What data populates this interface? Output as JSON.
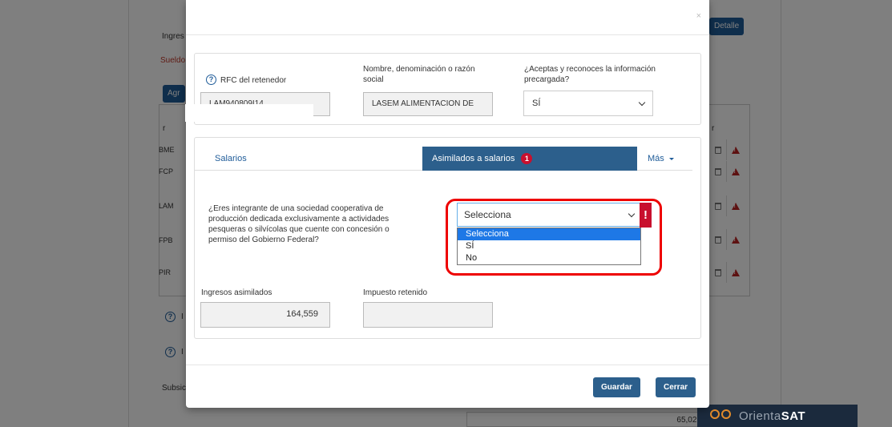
{
  "background": {
    "ingresos_label": "Ingres",
    "sueldos_label": "Sueldo",
    "agregar_label": "Agr",
    "detalle_button": "Detalle",
    "rows": [
      "BME",
      "FCP",
      "LAM",
      "FPB",
      "PIR"
    ],
    "col_header_left": "r",
    "col_header_right": "r",
    "help_row1": "I",
    "help_row2": "I",
    "subsidio_label": "Subsic",
    "amount_value": "65,021"
  },
  "orientasat": {
    "prefix": "Orienta",
    "brand": "SAT"
  },
  "modal": {
    "close_label": "×",
    "rfc_label": "RFC del retenedor",
    "rfc_value": "LAM940809I14",
    "nombre_label": "Nombre, denominación o razón social",
    "nombre_value": "LASEM ALIMENTACION DE",
    "aceptas_label": "¿Aceptas y reconoces la información precargada?",
    "aceptas_value": "SÍ",
    "tabs": {
      "salarios": "Salarios",
      "asimilados": "Asimilados a salarios",
      "asimilados_badge": "1",
      "mas": "Más"
    },
    "question": "¿Eres integrante de una sociedad cooperativa de producción dedicada exclusivamente a actividades pesqueras o silvícolas que cuente con concesión o permiso del Gobierno Federal?",
    "select_value": "Selecciona",
    "select_error": "!",
    "options": [
      "Selecciona",
      "SÍ",
      "No"
    ],
    "ingresos_label": "Ingresos asimilados",
    "ingresos_value": "164,559",
    "impuesto_label": "Impuesto retenido",
    "impuesto_value": "",
    "guardar_button": "Guardar",
    "cerrar_button": "Cerrar"
  },
  "colors": {
    "primary": "#2c5f8c",
    "error": "#c8102e",
    "highlight": "#e00000",
    "option_selected": "#1e78e6"
  }
}
